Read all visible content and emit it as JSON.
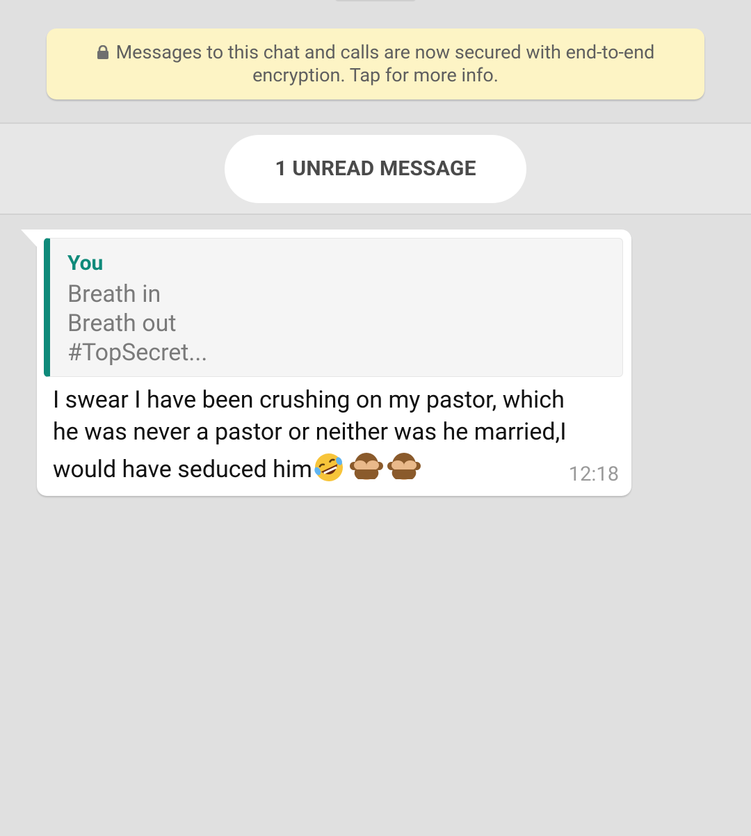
{
  "encryption_notice": {
    "icon": "lock-icon",
    "line1": "Messages to this chat and calls are now secured with end-to-end",
    "line2": "encryption. Tap for more info."
  },
  "unread_divider": {
    "label": "1 UNREAD MESSAGE"
  },
  "message": {
    "quoted": {
      "author": "You",
      "lines": [
        "Breath in",
        "Breath out",
        "#TopSecret..."
      ]
    },
    "text_lines": [
      "I swear I have been crushing on my pastor, which",
      "he was never a pastor or neither was he married,I",
      "would have seduced him"
    ],
    "emojis": [
      "rolling-on-floor-laughing-emoji",
      "see-no-evil-monkey-emoji",
      "see-no-evil-monkey-emoji"
    ],
    "time": "12:18"
  },
  "colors": {
    "chat_background": "#e0e0e0",
    "notice_background": "#fdf4c5",
    "quote_accent": "#0f8a7a",
    "bubble_background": "#ffffff"
  }
}
